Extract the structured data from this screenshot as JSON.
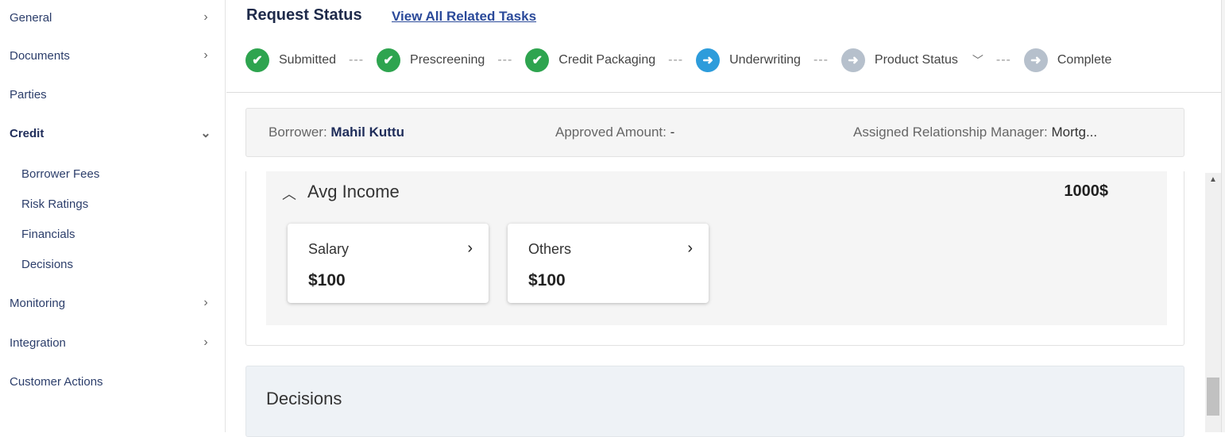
{
  "sidebar": {
    "items": [
      {
        "label": "General",
        "arrow": "›"
      },
      {
        "label": "Documents",
        "arrow": "›"
      },
      {
        "label": "Parties",
        "arrow": ""
      },
      {
        "label": "Credit",
        "arrow": "⌄"
      },
      {
        "label": "Monitoring",
        "arrow": "›"
      },
      {
        "label": "Integration",
        "arrow": "›"
      },
      {
        "label": "Customer Actions",
        "arrow": ""
      }
    ],
    "credit_subitems": [
      "Borrower Fees",
      "Risk Ratings",
      "Financials",
      "Decisions"
    ]
  },
  "header": {
    "title": "Request Status",
    "link": "View All Related Tasks",
    "steps": [
      {
        "label": "Submitted",
        "state": "done",
        "icon": "check-icon"
      },
      {
        "label": "Prescreening",
        "state": "done",
        "icon": "check-icon"
      },
      {
        "label": "Credit Packaging",
        "state": "done",
        "icon": "check-icon"
      },
      {
        "label": "Underwriting",
        "state": "current",
        "icon": "arrow-right-icon"
      },
      {
        "label": "Product Status",
        "state": "pending",
        "icon": "arrow-right-icon"
      },
      {
        "label": "Complete",
        "state": "pending",
        "icon": "arrow-right-icon"
      }
    ],
    "separator": "---"
  },
  "summary": {
    "borrower_label": "Borrower:",
    "borrower_value": "Mahil Kuttu",
    "approved_label": "Approved Amount:",
    "approved_value": "-",
    "manager_label": "Assigned Relationship Manager:",
    "manager_value": "Mortg..."
  },
  "income": {
    "title": "Avg Income",
    "total": "1000$",
    "cards": [
      {
        "label": "Salary",
        "value": "$100"
      },
      {
        "label": "Others",
        "value": "$100"
      }
    ]
  },
  "decisions": {
    "title": "Decisions"
  },
  "colors": {
    "done": "#2ea44f",
    "current": "#2d9cdb",
    "pending": "#b6c0cc",
    "nav_text": "#2c3e6b"
  }
}
